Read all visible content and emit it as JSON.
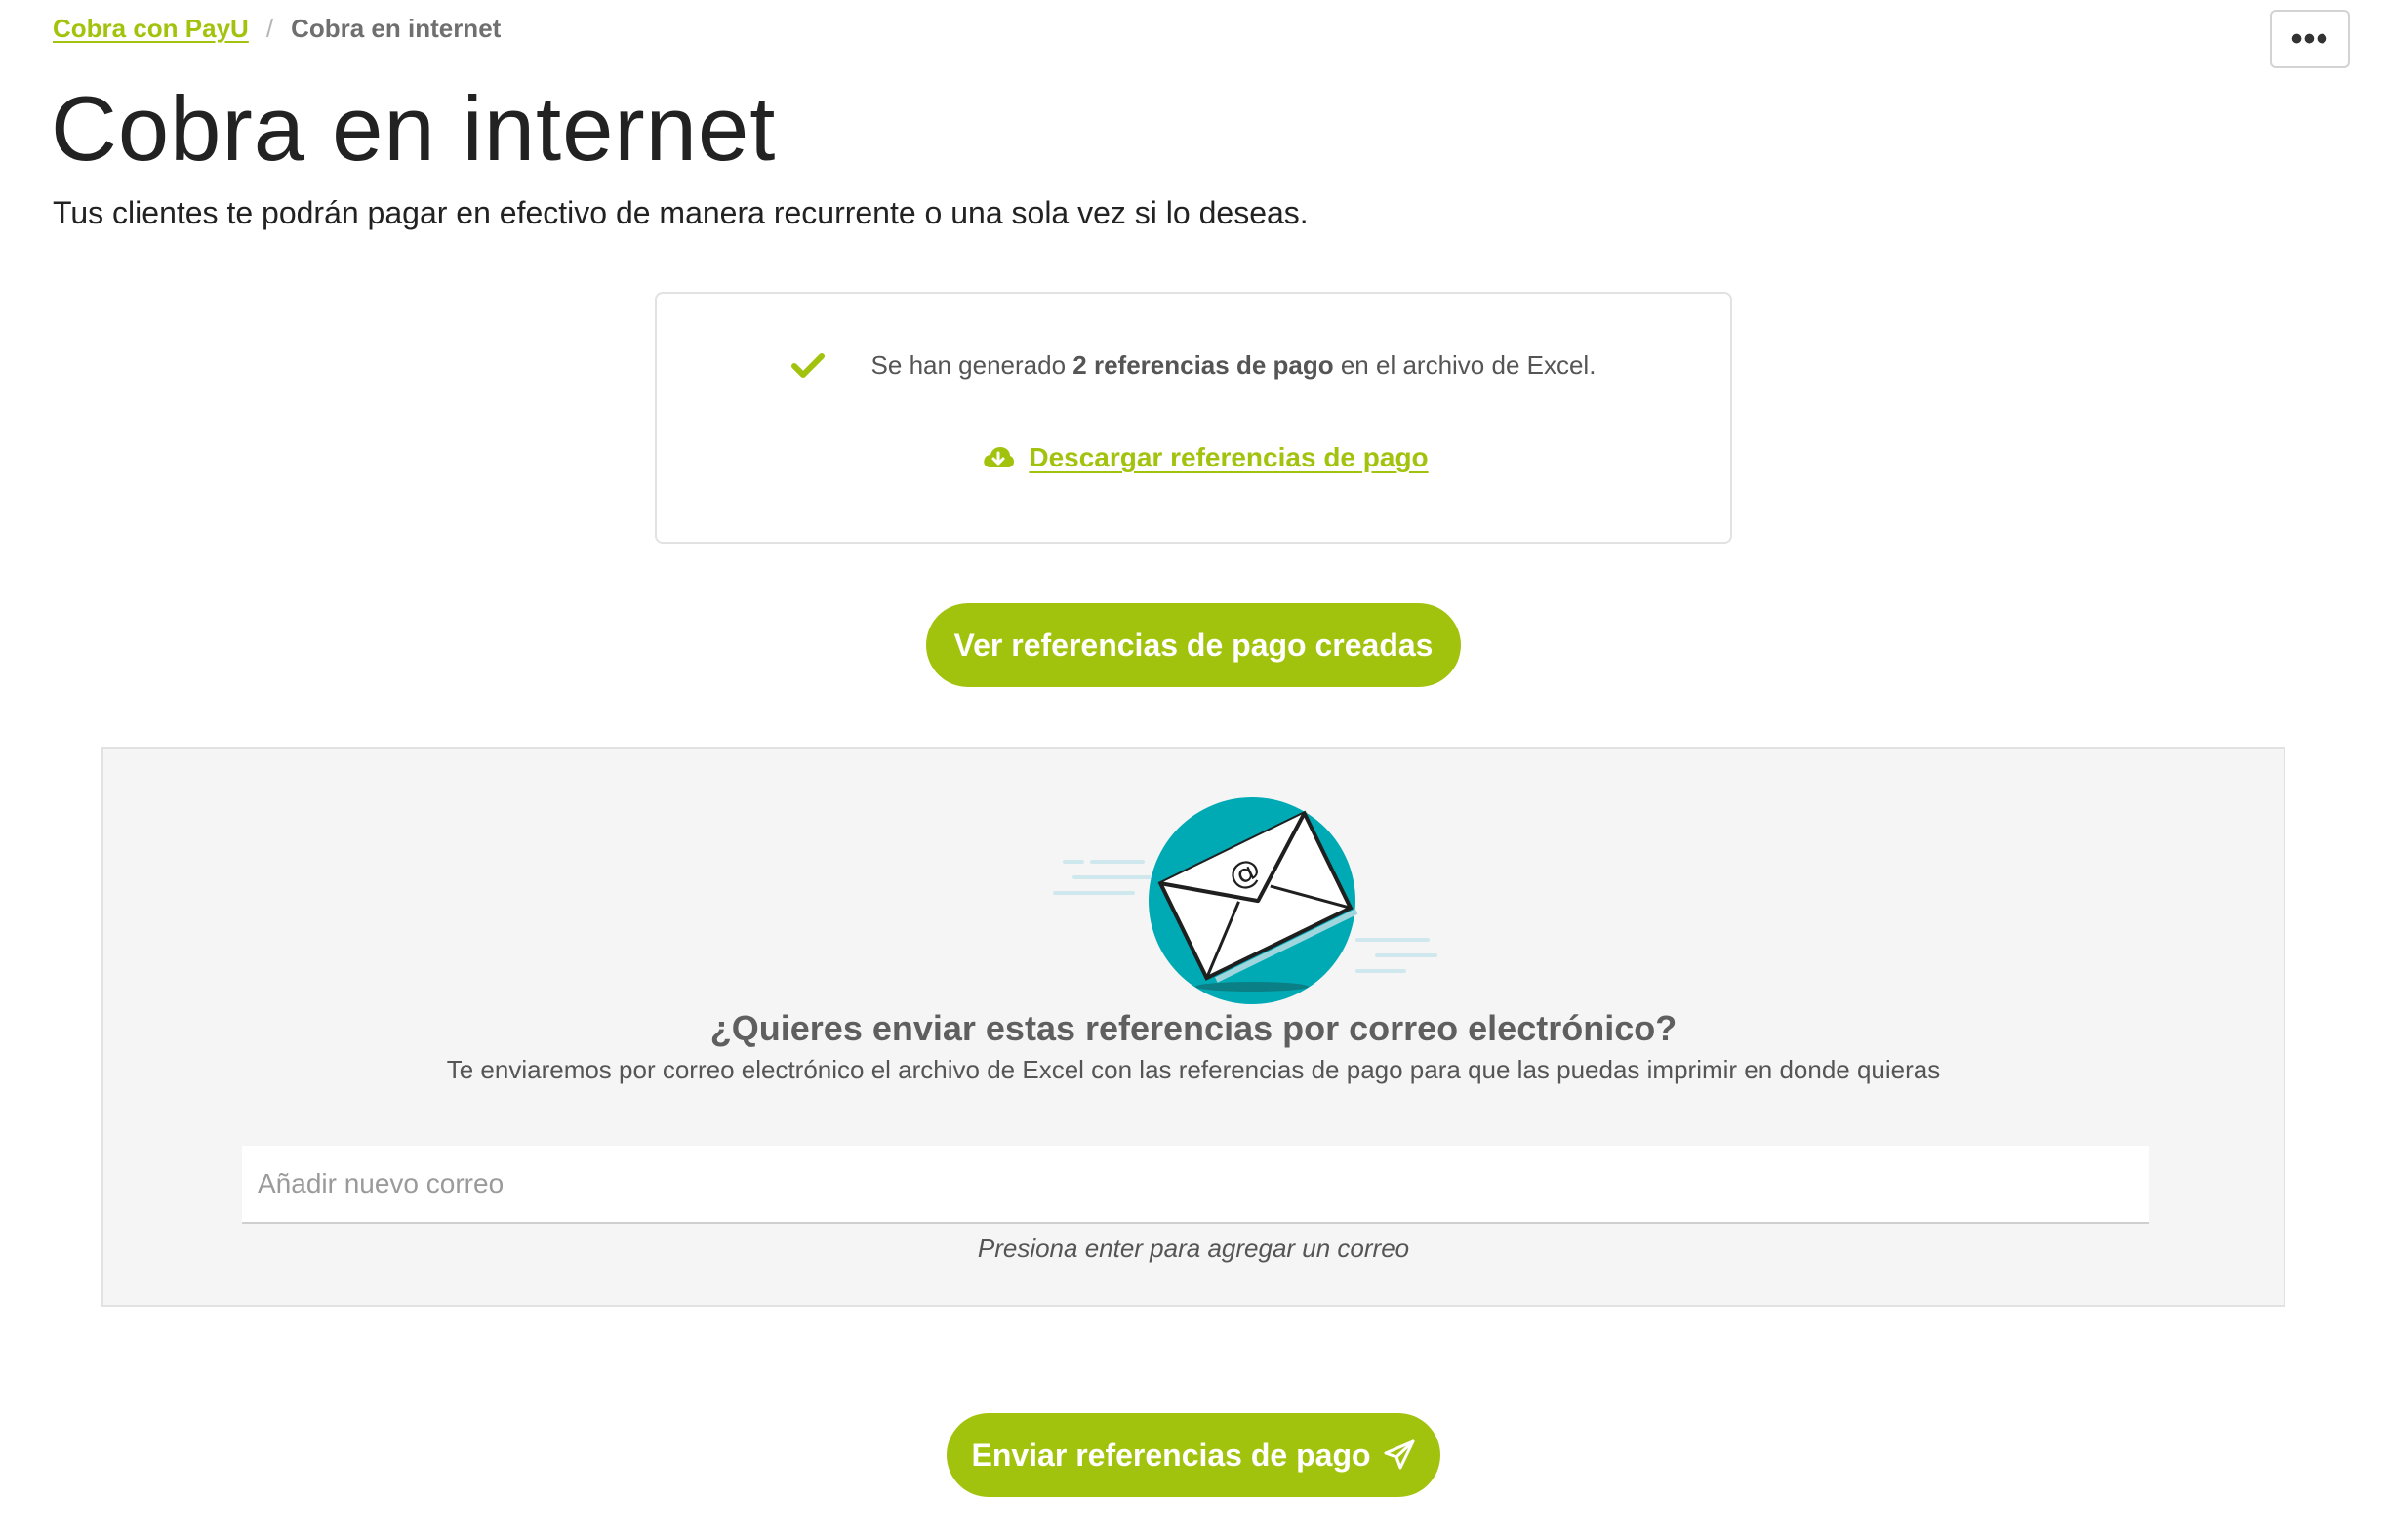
{
  "breadcrumb": {
    "parent_label": "Cobra con PayU",
    "separator": "/",
    "current_label": "Cobra en internet"
  },
  "header": {
    "more_label": "•••",
    "title": "Cobra en internet",
    "subtitle": "Tus clientes te podrán pagar en efectivo de manera recurrente o una sola vez si lo deseas."
  },
  "result": {
    "text_before": "Se han generado ",
    "text_bold": "2 referencias de pago",
    "text_after": " en el archivo de Excel.",
    "download_label": "Descargar referencias de pago",
    "icons": {
      "status": "check-icon",
      "download": "cloud-download-icon"
    }
  },
  "view_button": {
    "label": "Ver referencias de pago creadas"
  },
  "email_panel": {
    "illustration_text": "@",
    "question": "¿Quieres enviar estas referencias por correo electrónico?",
    "description": "Te enviaremos por correo electrónico el archivo de Excel con las referencias de pago para que las puedas imprimir en donde quieras",
    "input_placeholder": "Añadir nuevo correo",
    "input_value": "",
    "hint": "Presiona enter para agregar un correo"
  },
  "send_button": {
    "label": "Enviar referencias de pago",
    "icon": "paper-plane-icon"
  },
  "colors": {
    "accent": "#a2c30e",
    "teal": "#00aab5",
    "panel_bg": "#f5f5f5"
  }
}
